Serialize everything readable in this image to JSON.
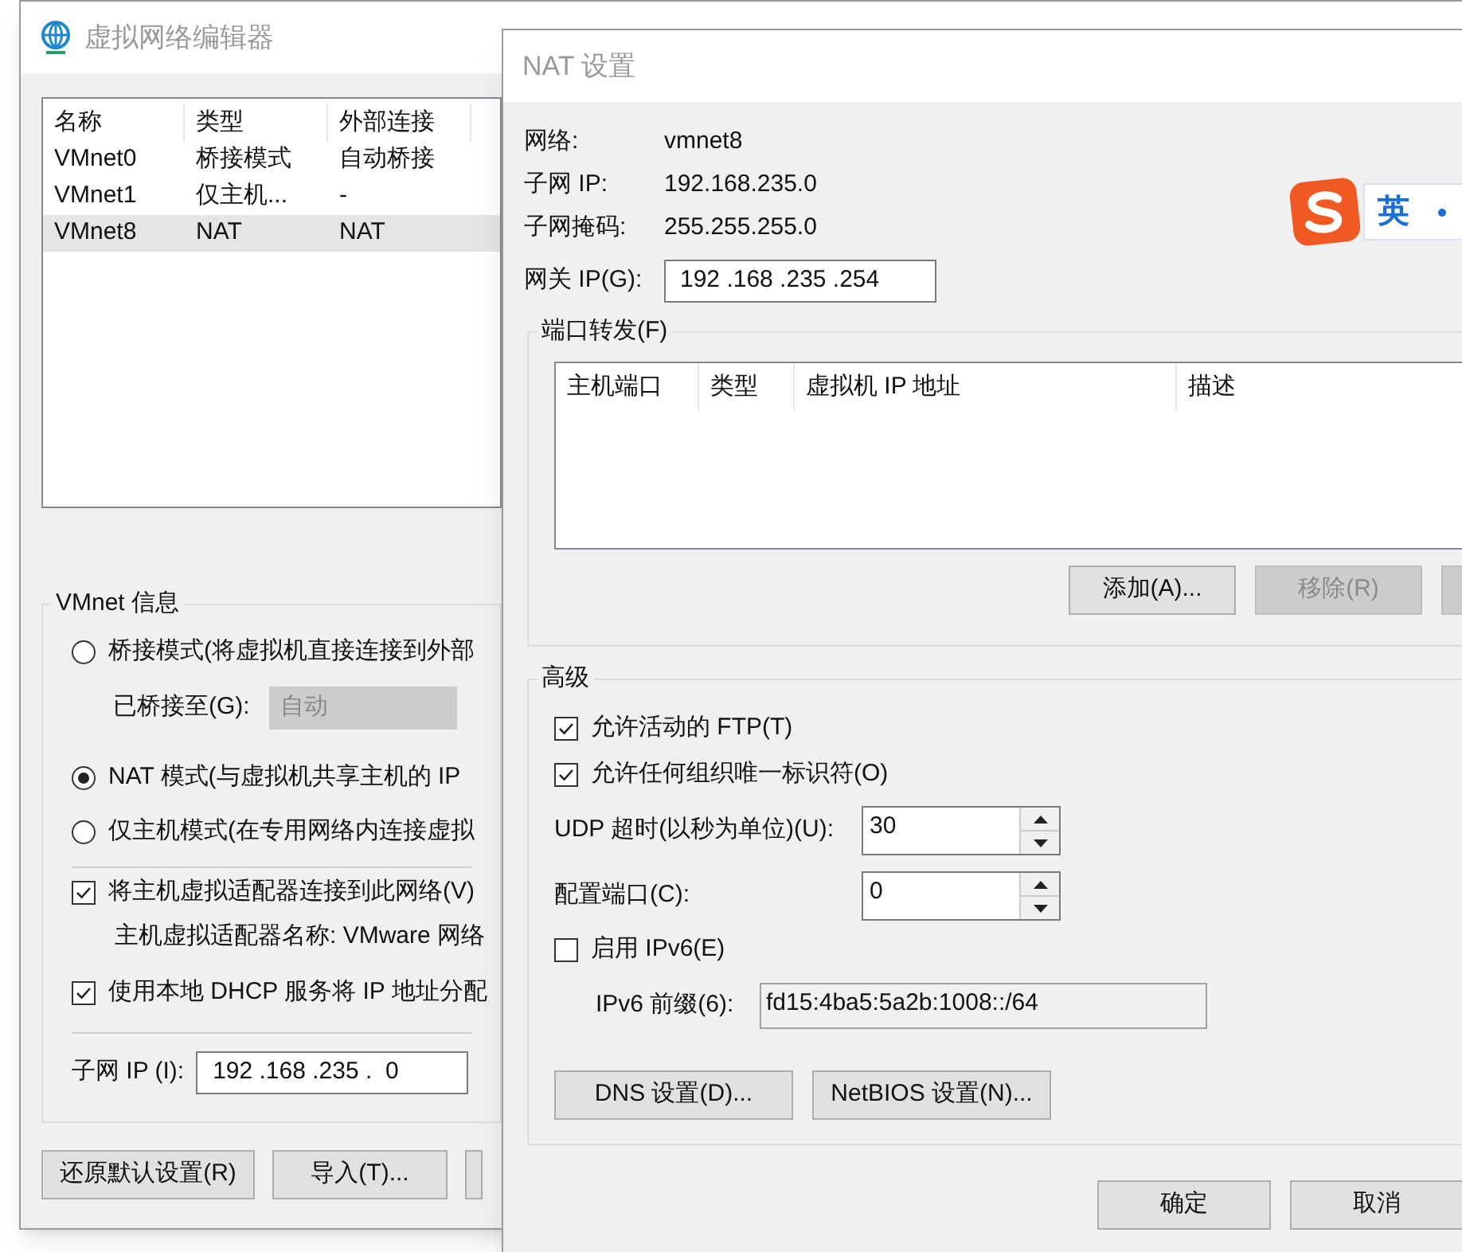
{
  "editor_window": {
    "title": "虚拟网络编辑器",
    "network_list": {
      "columns": [
        "名称",
        "类型",
        "外部连接"
      ],
      "rows": [
        {
          "cells": [
            "VMnet0",
            "桥接模式",
            "自动桥接"
          ],
          "selected": false
        },
        {
          "cells": [
            "VMnet1",
            "仅主机...",
            "-"
          ],
          "selected": false
        },
        {
          "cells": [
            "VMnet8",
            "NAT",
            "NAT"
          ],
          "selected": true
        }
      ]
    },
    "vmnet_info": {
      "title": "VMnet 信息",
      "modes": [
        {
          "label": "桥接模式(将虚拟机直接连接到外部",
          "selected": false
        },
        {
          "label": "NAT 模式(与虚拟机共享主机的 IP",
          "selected": true
        },
        {
          "label": "仅主机模式(在专用网络内连接虚拟",
          "selected": false
        }
      ],
      "bridged_to": {
        "label": "已桥接至(G):",
        "value": "自动",
        "disabled": true
      },
      "options": [
        {
          "label": "将主机虚拟适配器连接到此网络(V)",
          "checked": true
        },
        {
          "label": "使用本地 DHCP 服务将 IP 地址分配",
          "checked": true
        }
      ],
      "adapter_name": "主机虚拟适配器名称: VMware 网络",
      "subnet_ip": {
        "label": "子网 IP (I):",
        "value": "192 .168 .235 .  0"
      }
    },
    "buttons": [
      {
        "label": "还原默认设置(R)"
      },
      {
        "label": "导入(T)..."
      }
    ]
  },
  "nat_window": {
    "title": "NAT 设置",
    "info": [
      {
        "label": "网络:",
        "value": "vmnet8"
      },
      {
        "label": "子网 IP:",
        "value": "192.168.235.0"
      },
      {
        "label": "子网掩码:",
        "value": "255.255.255.0"
      }
    ],
    "gateway": {
      "label": "网关 IP(G):",
      "value": "192 .168 .235 .254"
    },
    "port_forwarding": {
      "title": "端口转发(F)",
      "columns": [
        "主机端口",
        "类型",
        "虚拟机 IP 地址",
        "描述"
      ],
      "buttons": [
        {
          "label": "添加(A)...",
          "disabled": false
        },
        {
          "label": "移除(R)",
          "disabled": true
        }
      ]
    },
    "advanced": {
      "title": "高级",
      "checkboxes": [
        {
          "label": "允许活动的 FTP(T)",
          "checked": true
        },
        {
          "label": "允许任何组织唯一标识符(O)",
          "checked": true
        }
      ],
      "udp_timeout": {
        "label": "UDP 超时(以秒为单位)(U):",
        "value": "30"
      },
      "config_port": {
        "label": "配置端口(C):",
        "value": "0"
      },
      "ipv6": {
        "label": "启用 IPv6(E)",
        "checked": false
      },
      "ipv6_prefix": {
        "label": "IPv6 前缀(6):",
        "value": "fd15:4ba5:5a2b:1008::/64",
        "disabled": true
      },
      "buttons": [
        {
          "label": "DNS 设置(D)..."
        },
        {
          "label": "NetBIOS 设置(N)..."
        }
      ]
    },
    "buttons": [
      {
        "label": "确定"
      },
      {
        "label": "取消"
      }
    ]
  },
  "ime_bar": {
    "mode": "英"
  }
}
